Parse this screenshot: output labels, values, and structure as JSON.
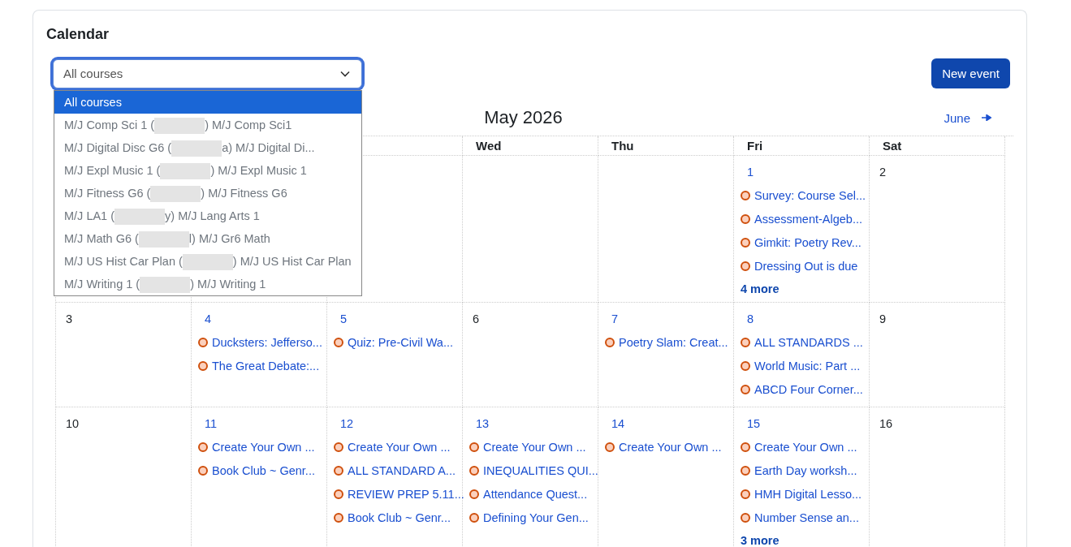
{
  "card": {
    "title": "Calendar"
  },
  "course_select": {
    "value": "All courses",
    "expanded": true,
    "options": [
      {
        "kind": "plain",
        "label": "All courses",
        "selected": true
      },
      {
        "kind": "redacted",
        "before": "M/J Comp Sci 1 (",
        "after": ") M/J Comp Sci1",
        "selected": false
      },
      {
        "kind": "redacted",
        "before": "M/J Digital Disc G6 (",
        "after": "a) M/J Digital Di...",
        "selected": false
      },
      {
        "kind": "redacted",
        "before": "M/J Expl Music 1 (",
        "after": ") M/J Expl Music 1",
        "selected": false
      },
      {
        "kind": "redacted",
        "before": "M/J Fitness G6 (",
        "after": ") M/J Fitness G6",
        "selected": false
      },
      {
        "kind": "redacted",
        "before": "M/J LA1 (",
        "after": "y) M/J Lang Arts 1",
        "selected": false
      },
      {
        "kind": "redacted",
        "before": "M/J Math G6 (",
        "after": "l) M/J Gr6 Math",
        "selected": false
      },
      {
        "kind": "redacted",
        "before": "M/J US Hist Car Plan (",
        "after": ") M/J US Hist Car Plan",
        "selected": false
      },
      {
        "kind": "redacted",
        "before": "M/J Writing 1 (",
        "after": ") M/J Writing 1",
        "selected": false
      }
    ]
  },
  "new_event_button": "New event",
  "month_title": "May 2026",
  "next_month": "June",
  "weekdays": [
    "Wed",
    "Thu",
    "Fri",
    "Sat"
  ],
  "weeks": [
    [
      {
        "kind": "blank"
      },
      {
        "kind": "blank"
      },
      {
        "kind": "blank"
      },
      {
        "kind": "blank"
      },
      {
        "kind": "blank"
      },
      {
        "kind": "day",
        "day": "1",
        "events": [
          "Survey: Course Sel...",
          "Assessment-Algeb...",
          "Gimkit: Poetry Rev...",
          "Dressing Out is due"
        ],
        "more": "4 more"
      },
      {
        "kind": "day",
        "day": "2"
      }
    ],
    [
      {
        "kind": "day",
        "day": "3"
      },
      {
        "kind": "day",
        "day": "4",
        "events": [
          "Ducksters: Jefferso...",
          "The Great Debate:..."
        ]
      },
      {
        "kind": "day",
        "day": "5",
        "events": [
          "Quiz: Pre-Civil Wa..."
        ]
      },
      {
        "kind": "day",
        "day": "6"
      },
      {
        "kind": "day",
        "day": "7",
        "events": [
          "Poetry Slam: Creat..."
        ]
      },
      {
        "kind": "day",
        "day": "8",
        "events": [
          "ALL STANDARDS ...",
          "World Music: Part ...",
          "ABCD Four Corner..."
        ]
      },
      {
        "kind": "day",
        "day": "9"
      }
    ],
    [
      {
        "kind": "day",
        "day": "10"
      },
      {
        "kind": "day",
        "day": "11",
        "events": [
          "Create Your Own ...",
          "Book Club ~ Genr..."
        ]
      },
      {
        "kind": "day",
        "day": "12",
        "events": [
          "Create Your Own ...",
          "ALL STANDARD A...",
          "REVIEW PREP 5.11...",
          "Book Club ~ Genr..."
        ]
      },
      {
        "kind": "day",
        "day": "13",
        "events": [
          "Create Your Own ...",
          "INEQUALITIES QUI...",
          "Attendance Quest...",
          "Defining Your Gen..."
        ]
      },
      {
        "kind": "day",
        "day": "14",
        "events": [
          "Create Your Own ..."
        ]
      },
      {
        "kind": "day",
        "day": "15",
        "events": [
          "Create Your Own ...",
          "Earth Day worksh...",
          "HMH Digital Lesso...",
          "Number Sense an..."
        ],
        "more": "3 more"
      },
      {
        "kind": "day",
        "day": "16"
      }
    ]
  ]
}
